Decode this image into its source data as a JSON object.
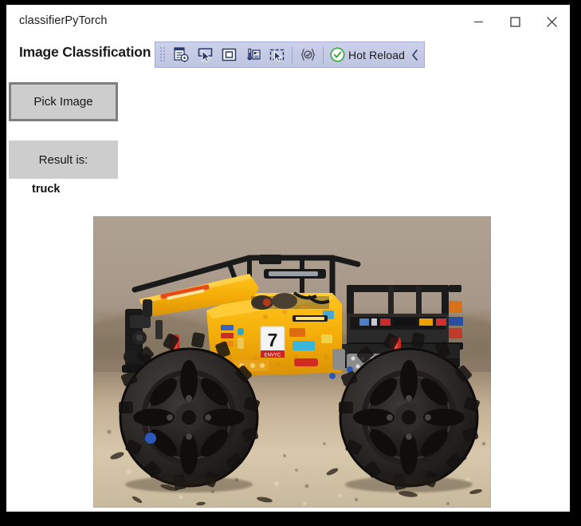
{
  "window": {
    "title": "classifierPyTorch",
    "controls": [
      {
        "name": "minimize",
        "label": "—"
      },
      {
        "name": "maximize",
        "label": "□"
      },
      {
        "name": "close",
        "label": "✕"
      }
    ]
  },
  "header": {
    "heading": "Image Classification"
  },
  "toolbar": {
    "name": "hot-reload-toolbar",
    "grip": "drag-grip",
    "buttons": [
      {
        "name": "live-visual-tree-icon",
        "tooltip": "Go To Live Visual Tree"
      },
      {
        "name": "select-element-icon",
        "tooltip": "Select Element"
      },
      {
        "name": "layout-adorners-icon",
        "tooltip": "Display Layout Adorners"
      },
      {
        "name": "live-property-explorer-icon",
        "tooltip": "Go To Live Property Explorer"
      },
      {
        "name": "track-focused-element-icon",
        "tooltip": "Track Focused Element"
      },
      {
        "name": "xaml-inspect-icon",
        "tooltip": "Enable XAML Inspect"
      }
    ],
    "hot_reload": {
      "label": "Hot Reload",
      "icon": "check-circle-icon",
      "status_color": "#3ba83b"
    },
    "collapse": {
      "name": "chevron-left-icon",
      "glyph": "‹"
    },
    "background_color": "#c6ccE6"
  },
  "main": {
    "pick_button": {
      "label": "Pick Image",
      "fill_color": "#cdcdcd",
      "border_color": "#7f7f7f"
    },
    "result_label": {
      "label": "Result is:",
      "fill_color": "#cdcdcd"
    },
    "result_value": "truck",
    "photo": {
      "name": "classified-image",
      "description": "Yellow LEGO Technic 4x4 X-treme Off-Roader truck on a granite countertop",
      "alt": "truck"
    }
  }
}
